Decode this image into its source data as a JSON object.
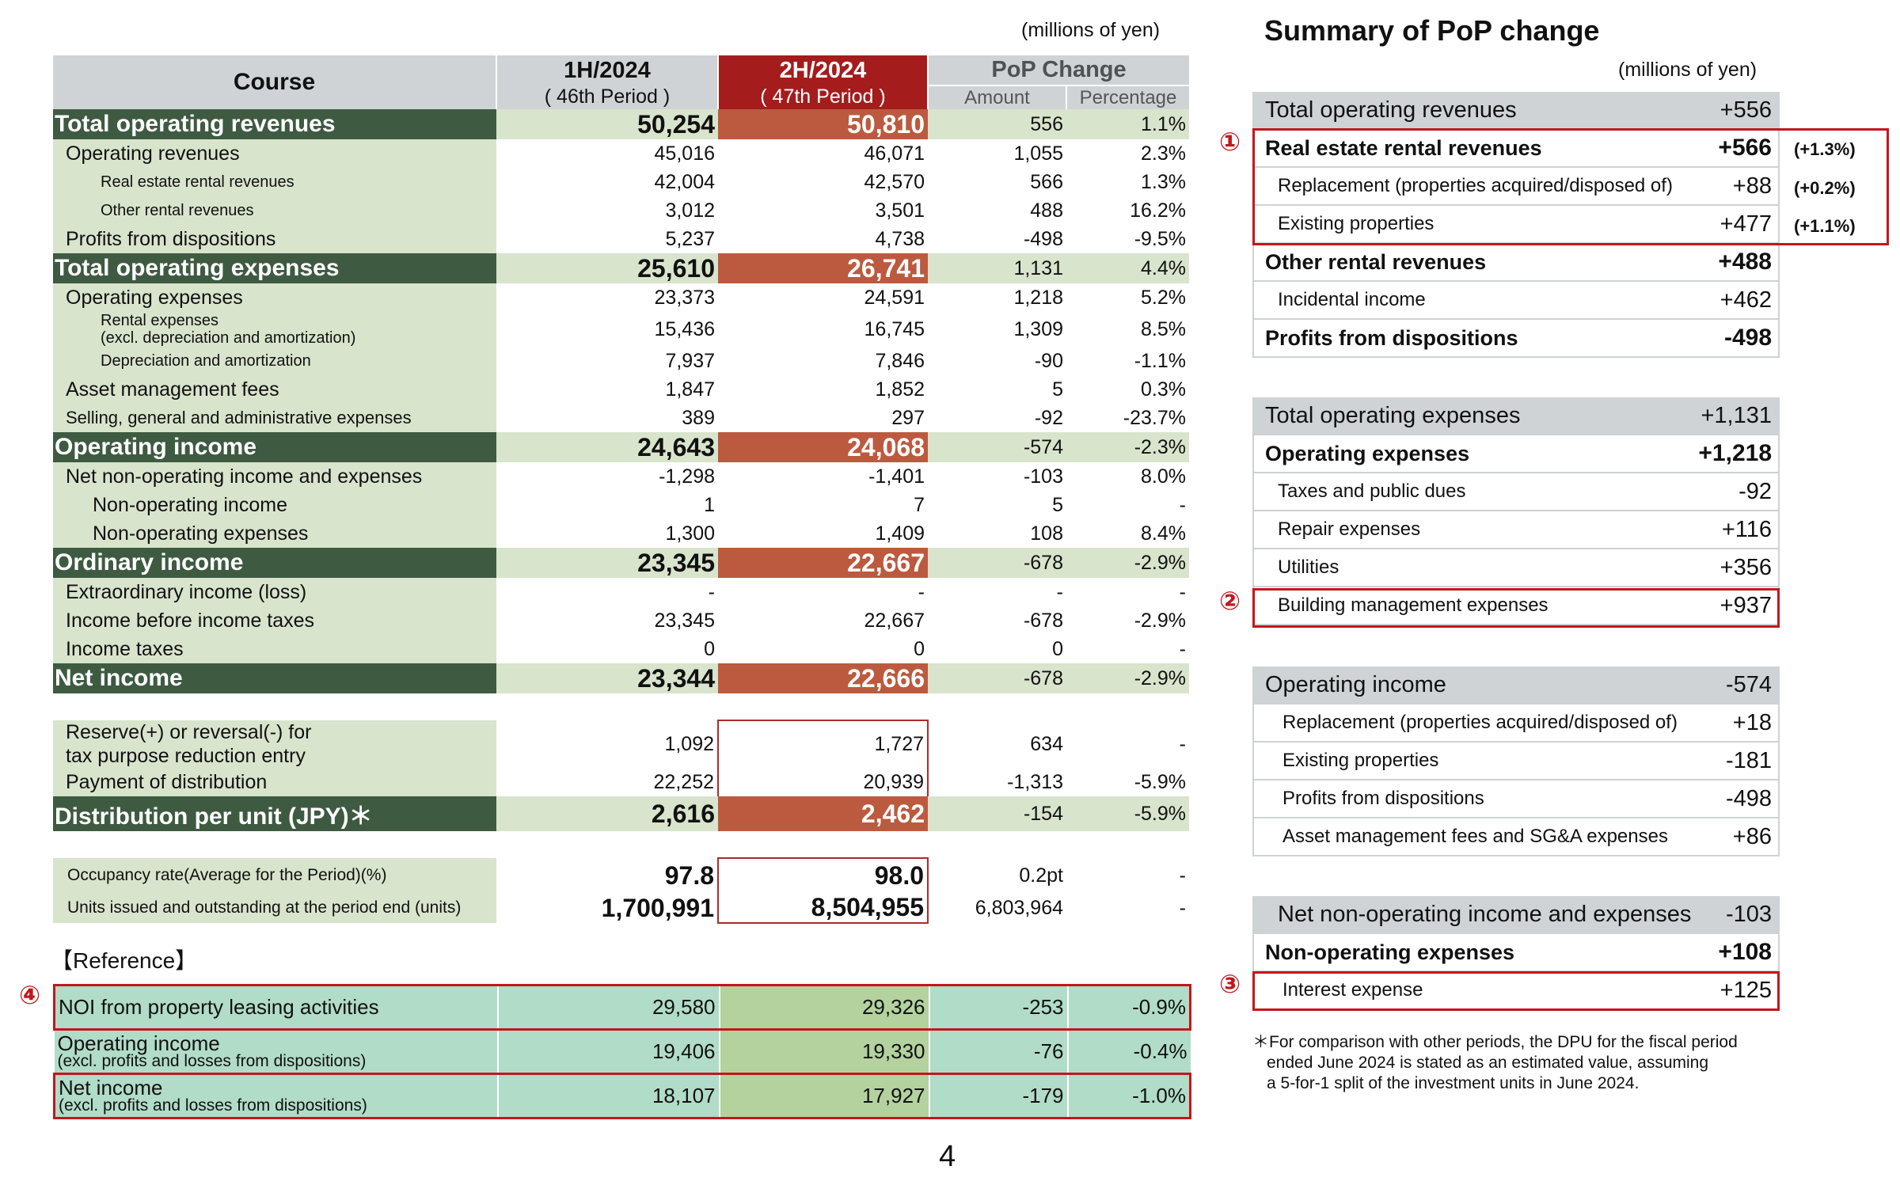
{
  "left": {
    "unit": "(millions of yen)",
    "header": {
      "course": "Course",
      "p1": "1H/2024",
      "p1_sub": "( 46th Period )",
      "p2": "2H/2024",
      "p2_sub": "( 47th Period )",
      "pop": "PoP Change",
      "amount": "Amount",
      "percentage": "Percentage"
    },
    "rows": [
      {
        "label": "Total operating revenues",
        "v1": "50,254",
        "v2": "50,810",
        "amt": "556",
        "pct": "1.1%"
      },
      {
        "label": "Operating revenues",
        "v1": "45,016",
        "v2": "46,071",
        "amt": "1,055",
        "pct": "2.3%"
      },
      {
        "label": "Real estate rental revenues",
        "v1": "42,004",
        "v2": "42,570",
        "amt": "566",
        "pct": "1.3%"
      },
      {
        "label": "Other rental revenues",
        "v1": "3,012",
        "v2": "3,501",
        "amt": "488",
        "pct": "16.2%"
      },
      {
        "label": "Profits from dispositions",
        "v1": "5,237",
        "v2": "4,738",
        "amt": "-498",
        "pct": "-9.5%"
      },
      {
        "label": "Total operating expenses",
        "v1": "25,610",
        "v2": "26,741",
        "amt": "1,131",
        "pct": "4.4%"
      },
      {
        "label": "Operating expenses",
        "v1": "23,373",
        "v2": "24,591",
        "amt": "1,218",
        "pct": "5.2%"
      },
      {
        "label": "Rental expenses",
        "label2": "(excl. depreciation and amortization)",
        "v1": "15,436",
        "v2": "16,745",
        "amt": "1,309",
        "pct": "8.5%"
      },
      {
        "label": "Depreciation and amortization",
        "v1": "7,937",
        "v2": "7,846",
        "amt": "-90",
        "pct": "-1.1%"
      },
      {
        "label": "Asset management fees",
        "v1": "1,847",
        "v2": "1,852",
        "amt": "5",
        "pct": "0.3%"
      },
      {
        "label": "Selling, general and administrative expenses",
        "v1": "389",
        "v2": "297",
        "amt": "-92",
        "pct": "-23.7%"
      },
      {
        "label": "Operating income",
        "v1": "24,643",
        "v2": "24,068",
        "amt": "-574",
        "pct": "-2.3%"
      },
      {
        "label": "Net non-operating income and expenses",
        "v1": "-1,298",
        "v2": "-1,401",
        "amt": "-103",
        "pct": "8.0%"
      },
      {
        "label": "Non-operating income",
        "v1": "1",
        "v2": "7",
        "amt": "5",
        "pct": "-"
      },
      {
        "label": "Non-operating expenses",
        "v1": "1,300",
        "v2": "1,409",
        "amt": "108",
        "pct": "8.4%"
      },
      {
        "label": "Ordinary income",
        "v1": "23,345",
        "v2": "22,667",
        "amt": "-678",
        "pct": "-2.9%"
      },
      {
        "label": "Extraordinary income (loss)",
        "v1": "-",
        "v2": "-",
        "amt": "-",
        "pct": "-"
      },
      {
        "label": "Income before income taxes",
        "v1": "23,345",
        "v2": "22,667",
        "amt": "-678",
        "pct": "-2.9%"
      },
      {
        "label": "Income taxes",
        "v1": "0",
        "v2": "0",
        "amt": "0",
        "pct": "-"
      },
      {
        "label": "Net income",
        "v1": "23,344",
        "v2": "22,666",
        "amt": "-678",
        "pct": "-2.9%"
      },
      {
        "label": "Reserve(+) or reversal(-) for",
        "label2": "tax purpose reduction entry",
        "v1": "1,092",
        "v2": "1,727",
        "amt": "634",
        "pct": "-"
      },
      {
        "label": "Payment of distribution",
        "v1": "22,252",
        "v2": "20,939",
        "amt": "-1,313",
        "pct": "-5.9%"
      },
      {
        "label": "Distribution per unit (JPY)＊",
        "v1": "2,616",
        "v2": "2,462",
        "amt": "-154",
        "pct": "-5.9%"
      },
      {
        "label": "Occupancy rate(Average for the Period)(%)",
        "v1": "97.8",
        "v2": "98.0",
        "amt": "0.2pt",
        "pct": "-"
      },
      {
        "label": "Units issued and outstanding at the period end  (units)",
        "v1": "1,700,991",
        "v2": "8,504,955",
        "amt": "6,803,964",
        "pct": "-"
      }
    ],
    "reference_label": "【Reference】",
    "reference": [
      {
        "label": "NOI from property leasing activities",
        "v1": "29,580",
        "v2": "29,326",
        "amt": "-253",
        "pct": "-0.9%"
      },
      {
        "label": "Operating income",
        "label2": "(excl. profits and losses from dispositions)",
        "v1": "19,406",
        "v2": "19,330",
        "amt": "-76",
        "pct": "-0.4%"
      },
      {
        "label": "Net income",
        "label2": "(excl. profits and losses from dispositions)",
        "v1": "18,107",
        "v2": "17,927",
        "amt": "-179",
        "pct": "-1.0%"
      }
    ],
    "marks": {
      "m4": "④"
    }
  },
  "right": {
    "title": "Summary of PoP change",
    "unit": "(millions of yen)",
    "g1": [
      {
        "label": "Total operating revenues",
        "value": "+556"
      },
      {
        "label": "Real estate rental revenues",
        "value": "+566",
        "note": "(+1.3%)"
      },
      {
        "label": "Replacement (properties acquired/disposed of)",
        "value": "+88",
        "note": "(+0.2%)"
      },
      {
        "label": "Existing properties",
        "value": "+477",
        "note": "(+1.1%)"
      },
      {
        "label": "Other rental revenues",
        "value": "+488"
      },
      {
        "label": "Incidental income",
        "value": "+462"
      },
      {
        "label": "Profits from dispositions",
        "value": "-498"
      }
    ],
    "g2": [
      {
        "label": "Total operating expenses",
        "value": "+1,131"
      },
      {
        "label": "Operating expenses",
        "value": "+1,218"
      },
      {
        "label": "Taxes and public dues",
        "value": "-92"
      },
      {
        "label": "Repair expenses",
        "value": "+116"
      },
      {
        "label": "Utilities",
        "value": "+356"
      },
      {
        "label": "Building management expenses",
        "value": "+937"
      }
    ],
    "g3": [
      {
        "label": "Operating income",
        "value": "-574"
      },
      {
        "label": "Replacement (properties acquired/disposed of)",
        "value": "+18"
      },
      {
        "label": "Existing properties",
        "value": "-181"
      },
      {
        "label": "Profits from dispositions",
        "value": "-498"
      },
      {
        "label": "Asset management fees and SG&A expenses",
        "value": "+86"
      }
    ],
    "g4": [
      {
        "label": "Net non-operating income and expenses",
        "value": "-103"
      },
      {
        "label": "Non-operating expenses",
        "value": "+108"
      },
      {
        "label": "Interest expense",
        "value": "+125"
      }
    ],
    "marks": {
      "m1": "①",
      "m2": "②",
      "m3": "③"
    },
    "footnote": [
      "＊For comparison with other periods, the DPU for the fiscal period",
      "ended June 2024 is stated as an estimated value, assuming",
      "a 5-for-1 split of the investment units in June 2024."
    ]
  },
  "page_number": "4"
}
